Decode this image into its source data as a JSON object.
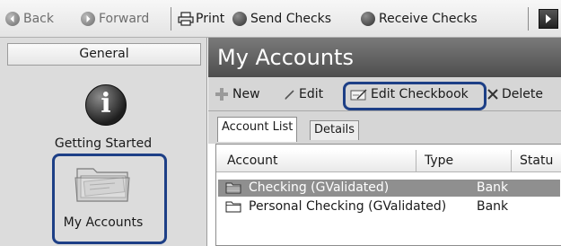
{
  "toolbar": {
    "back_label": "Back",
    "forward_label": "Forward",
    "print_label": "Print",
    "send_checks_label": "Send Checks",
    "receive_checks_label": "Receive Checks"
  },
  "sidebar": {
    "header": "General",
    "items": [
      {
        "label": "Getting Started",
        "icon": "info-icon"
      },
      {
        "label": "My Accounts",
        "icon": "checkbook-folder-icon"
      }
    ]
  },
  "main": {
    "title": "My Accounts",
    "actions": {
      "new_label": "New",
      "edit_label": "Edit",
      "edit_checkbook_label": "Edit Checkbook",
      "delete_label": "Delete"
    },
    "tabs": [
      {
        "label": "Account List",
        "active": true
      },
      {
        "label": "Details",
        "active": false
      }
    ],
    "table": {
      "columns": [
        "Account",
        "Type",
        "Statu"
      ],
      "rows": [
        {
          "account": "Checking (GValidated)",
          "type": "Bank",
          "selected": true
        },
        {
          "account": "Personal Checking (GValidated)",
          "type": "Bank",
          "selected": false
        }
      ]
    }
  },
  "colors": {
    "highlight_box": "#1d3f86",
    "title_bar": "#5e5e5e",
    "selected_row": "#8f8f8f"
  }
}
